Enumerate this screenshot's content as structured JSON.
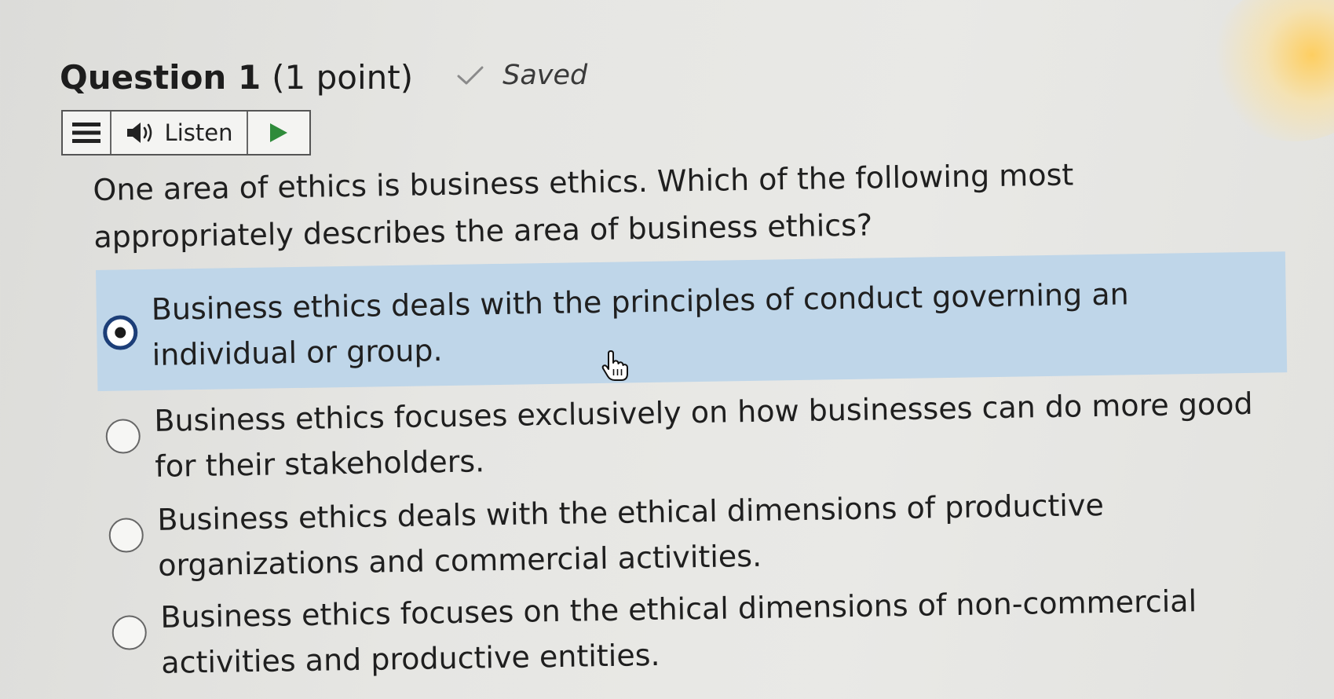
{
  "question": {
    "title": "Question 1",
    "points": "(1 point)",
    "status": "Saved",
    "text": "One area of ethics is business ethics. Which of the following most appropriately describes the area of business ethics?"
  },
  "listen_toolbar": {
    "menu_icon": "hamburger-menu-icon",
    "speaker_icon": "speaker-icon",
    "listen_label": "Listen",
    "play_icon": "play-icon"
  },
  "options": [
    {
      "label": "Business ethics deals with the principles of conduct governing an individual or group.",
      "selected": true
    },
    {
      "label": "Business ethics focuses exclusively on how businesses can do more good for their stakeholders.",
      "selected": false
    },
    {
      "label": "Business ethics deals with the ethical dimensions of productive organizations and commercial activities.",
      "selected": false
    },
    {
      "label": "Business ethics focuses on the ethical dimensions of non-commercial activities and productive entities.",
      "selected": false
    }
  ],
  "colors": {
    "selected_background": "#bfd6e9",
    "radio_checked": "#1c3e78",
    "play_icon": "#2e8b3a",
    "saved_check": "#8a8a8a"
  }
}
